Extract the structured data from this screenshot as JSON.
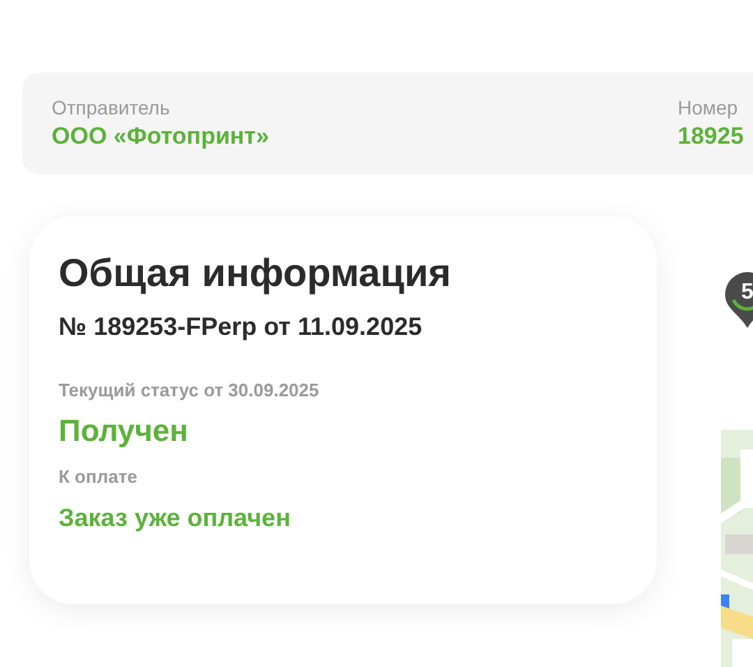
{
  "header": {
    "fields": [
      {
        "label": "Отправитель",
        "value": "ООО «Фотопринт»"
      },
      {
        "label": "Номер",
        "value": "18925"
      }
    ]
  },
  "info_card": {
    "title": "Общая информация",
    "order": "№ 189253-FPerp от 11.09.2025",
    "status_label": "Текущий статус от 30.09.2025",
    "status": "Получен",
    "payment_label": "К оплате",
    "payment": "Заказ уже оплачен"
  },
  "map": {
    "pin_label": "5",
    "kind": "picture"
  }
}
